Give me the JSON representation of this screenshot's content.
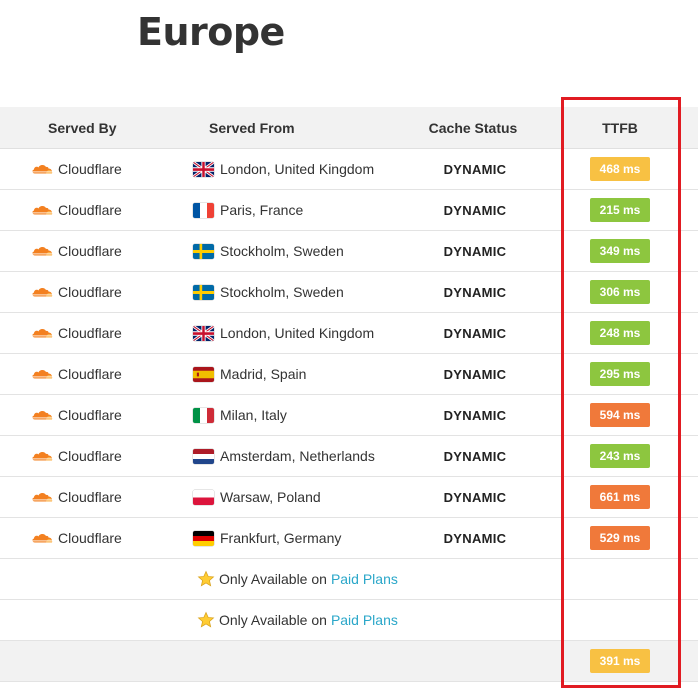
{
  "region": "Europe",
  "columns": {
    "served_by": "Served By",
    "served_from": "Served From",
    "cache_status": "Cache Status",
    "ttfb": "TTFB"
  },
  "colors": {
    "fast": "#8dc63f",
    "medium": "#f8c143",
    "slow": "#f0793a",
    "highlight": "#e11b22",
    "link": "#2aa7c9",
    "cloudflare": "#f38020"
  },
  "rows": [
    {
      "provider": "Cloudflare",
      "flag": "uk-flag-icon",
      "location": "London, United Kingdom",
      "cache": "DYNAMIC",
      "ttfb": "468 ms",
      "speed": "medium"
    },
    {
      "provider": "Cloudflare",
      "flag": "france-flag-icon",
      "location": "Paris, France",
      "cache": "DYNAMIC",
      "ttfb": "215 ms",
      "speed": "fast"
    },
    {
      "provider": "Cloudflare",
      "flag": "sweden-flag-icon",
      "location": "Stockholm, Sweden",
      "cache": "DYNAMIC",
      "ttfb": "349 ms",
      "speed": "fast"
    },
    {
      "provider": "Cloudflare",
      "flag": "sweden-flag-icon",
      "location": "Stockholm, Sweden",
      "cache": "DYNAMIC",
      "ttfb": "306 ms",
      "speed": "fast"
    },
    {
      "provider": "Cloudflare",
      "flag": "uk-flag-icon",
      "location": "London, United Kingdom",
      "cache": "DYNAMIC",
      "ttfb": "248 ms",
      "speed": "fast"
    },
    {
      "provider": "Cloudflare",
      "flag": "spain-flag-icon",
      "location": "Madrid, Spain",
      "cache": "DYNAMIC",
      "ttfb": "295 ms",
      "speed": "fast"
    },
    {
      "provider": "Cloudflare",
      "flag": "italy-flag-icon",
      "location": "Milan, Italy",
      "cache": "DYNAMIC",
      "ttfb": "594 ms",
      "speed": "slow"
    },
    {
      "provider": "Cloudflare",
      "flag": "netherlands-flag-icon",
      "location": "Amsterdam, Netherlands",
      "cache": "DYNAMIC",
      "ttfb": "243 ms",
      "speed": "fast"
    },
    {
      "provider": "Cloudflare",
      "flag": "poland-flag-icon",
      "location": "Warsaw, Poland",
      "cache": "DYNAMIC",
      "ttfb": "661 ms",
      "speed": "slow"
    },
    {
      "provider": "Cloudflare",
      "flag": "germany-flag-icon",
      "location": "Frankfurt, Germany",
      "cache": "DYNAMIC",
      "ttfb": "529 ms",
      "speed": "slow"
    }
  ],
  "paid_rows": [
    {
      "icon": "star-icon",
      "text": "Only Available on",
      "link": "Paid Plans"
    },
    {
      "icon": "star-icon",
      "text": "Only Available on",
      "link": "Paid Plans"
    }
  ],
  "footer": {
    "average_ttfb": "391 ms",
    "speed": "medium"
  }
}
